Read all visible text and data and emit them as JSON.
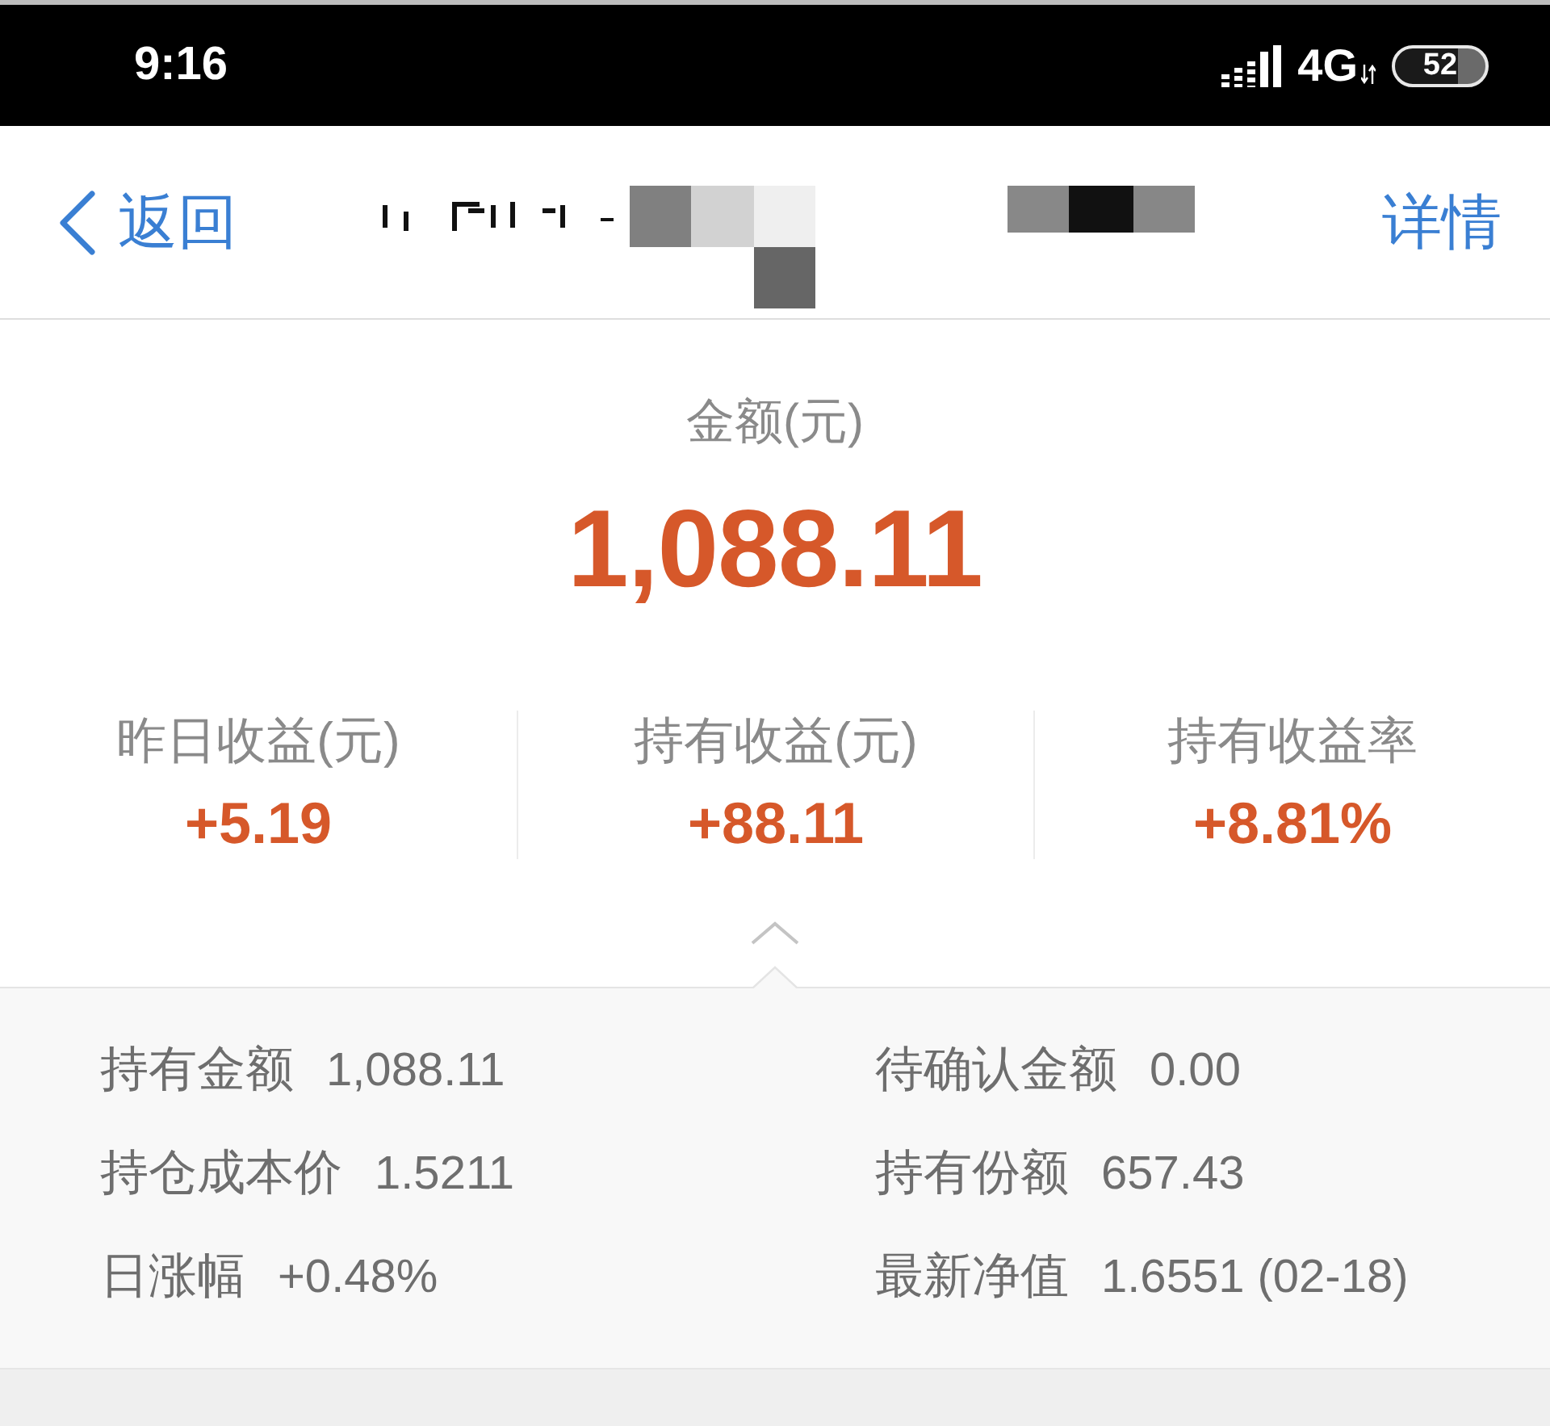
{
  "status_bar": {
    "time": "9:16",
    "network": "4G",
    "battery": "52"
  },
  "nav_bar": {
    "back_label": "返回",
    "action": "详情"
  },
  "summary": {
    "label": "金额(元)",
    "amount": "1,088.11"
  },
  "stats": [
    {
      "label": "昨日收益(元)",
      "value": "+5.19"
    },
    {
      "label": "持有收益(元)",
      "value": "+88.11"
    },
    {
      "label": "持有收益率",
      "value": "+8.81%"
    }
  ],
  "details": {
    "expanded": true,
    "items": [
      {
        "label": "持有金额",
        "value": "1,088.11"
      },
      {
        "label": "待确认金额",
        "value": "0.00"
      },
      {
        "label": "持仓成本价",
        "value": "1.5211"
      },
      {
        "label": "持有份额",
        "value": "657.43"
      },
      {
        "label": "日涨幅",
        "value": "+0.48%"
      },
      {
        "label": "最新净值",
        "value": "1.6551 (02-18)"
      }
    ]
  }
}
